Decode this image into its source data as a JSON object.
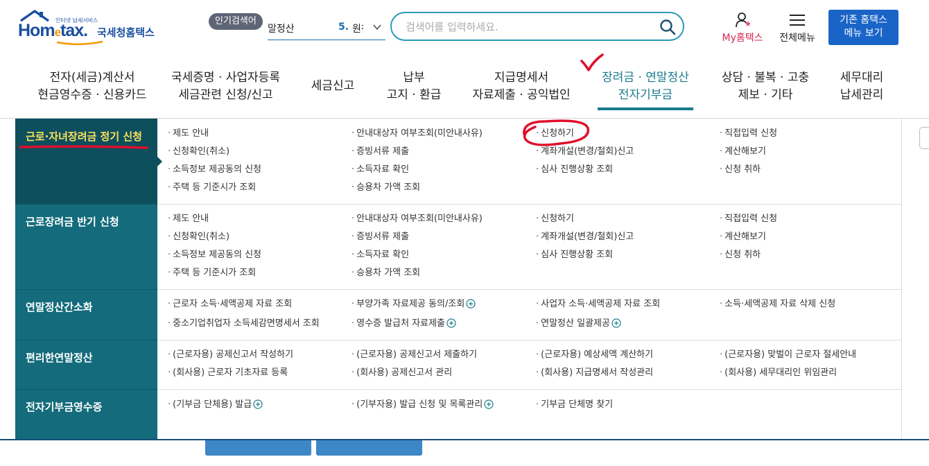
{
  "header": {
    "logo": {
      "sub": "인터넷 납세서비스",
      "brand_a": "Hom",
      "brand_e": "e",
      "brand_b": "tax.",
      "kr": "국세청홈택스"
    },
    "popular": {
      "badge": "인기검색어",
      "word": "말정산",
      "rank": "5.",
      "rank_word": "원천"
    },
    "search": {
      "placeholder": "검색어를 입력하세요."
    },
    "my_home_label": "My홈택스",
    "all_menu_label": "전체메뉴",
    "old_home_line1": "기존 홈택스",
    "old_home_line2": "메뉴 보기"
  },
  "nav": [
    {
      "line1": "전자(세금)계산서",
      "line2": "현금영수증 · 신용카드"
    },
    {
      "line1": "국세증명 · 사업자등록",
      "line2": "세금관련 신청/신고"
    },
    {
      "line1": "세금신고",
      "line2": ""
    },
    {
      "line1": "납부",
      "line2": "고지 · 환급"
    },
    {
      "line1": "지급명세서",
      "line2": "자료제출 · 공익법인"
    },
    {
      "line1": "장려금 · 연말정산",
      "line2": "전자기부금"
    },
    {
      "line1": "상담 · 불복 · 고충",
      "line2": "제보 · 기타"
    },
    {
      "line1": "세무대리",
      "line2": "납세관리"
    }
  ],
  "categories": [
    {
      "name": "근로·자녀장려금 정기 신청",
      "links": [
        [
          "제도 안내",
          "안내대상자 여부조회(미안내사유)",
          "신청하기",
          "직접입력 신청"
        ],
        [
          "신청확인(취소)",
          "증빙서류 제출",
          "계좌개설(변경/철회)신고",
          "계산해보기"
        ],
        [
          "소득정보 제공동의 신청",
          "소득자료 확인",
          "심사 진행상황 조회",
          "신청 취하"
        ],
        [
          "주택 등 기준시가 조회",
          "승용차 가액 조회",
          "",
          ""
        ]
      ]
    },
    {
      "name": "근로장려금 반기 신청",
      "links": [
        [
          "제도 안내",
          "안내대상자 여부조회(미안내사유)",
          "신청하기",
          "직접입력 신청"
        ],
        [
          "신청확인(취소)",
          "증빙서류 제출",
          "계좌개설(변경/철회)신고",
          "계산해보기"
        ],
        [
          "소득정보 제공동의 신청",
          "소득자료 확인",
          "심사 진행상황 조회",
          "신청 취하"
        ],
        [
          "주택 등 기준시가 조회",
          "승용차 가액 조회",
          "",
          ""
        ]
      ]
    },
    {
      "name": "연말정산간소화",
      "links": [
        [
          "근로자 소득·세액공제 자료 조회",
          "부양가족 자료제공 동의/조회",
          "사업자 소득·세액공제 자료 조회",
          "소득·세액공제 자료 삭제 신청"
        ],
        [
          "중소기업취업자 소득세감면명세서 조회",
          "영수증 발급처 자료제출",
          "연말정산 일괄제공",
          ""
        ]
      ]
    },
    {
      "name": "편리한연말정산",
      "links": [
        [
          "(근로자용) 공제신고서 작성하기",
          "(근로자용) 공제신고서 제출하기",
          "(근로자용) 예상세액 계산하기",
          "(근로자용) 맞벌이 근로자 절세안내"
        ],
        [
          "(회사용) 근로자 기초자료 등록",
          "(회사용) 공제신고서 관리",
          "(회사용) 지급명세서 작성관리",
          "(회사용) 세무대리인 위임관리"
        ]
      ]
    },
    {
      "name": "전자기부금영수증",
      "links": [
        [
          "(기부금 단체용) 발급",
          "(기부자용) 발급 신청 및 목록관리",
          "기부금 단체명 찾기",
          ""
        ]
      ]
    }
  ],
  "colors": {
    "accent": "#136b7b",
    "accent_dark": "#0e4f5d",
    "highlight": "#ffe25a",
    "brand": "#1b4fa0",
    "annotation": "#e0102a"
  }
}
